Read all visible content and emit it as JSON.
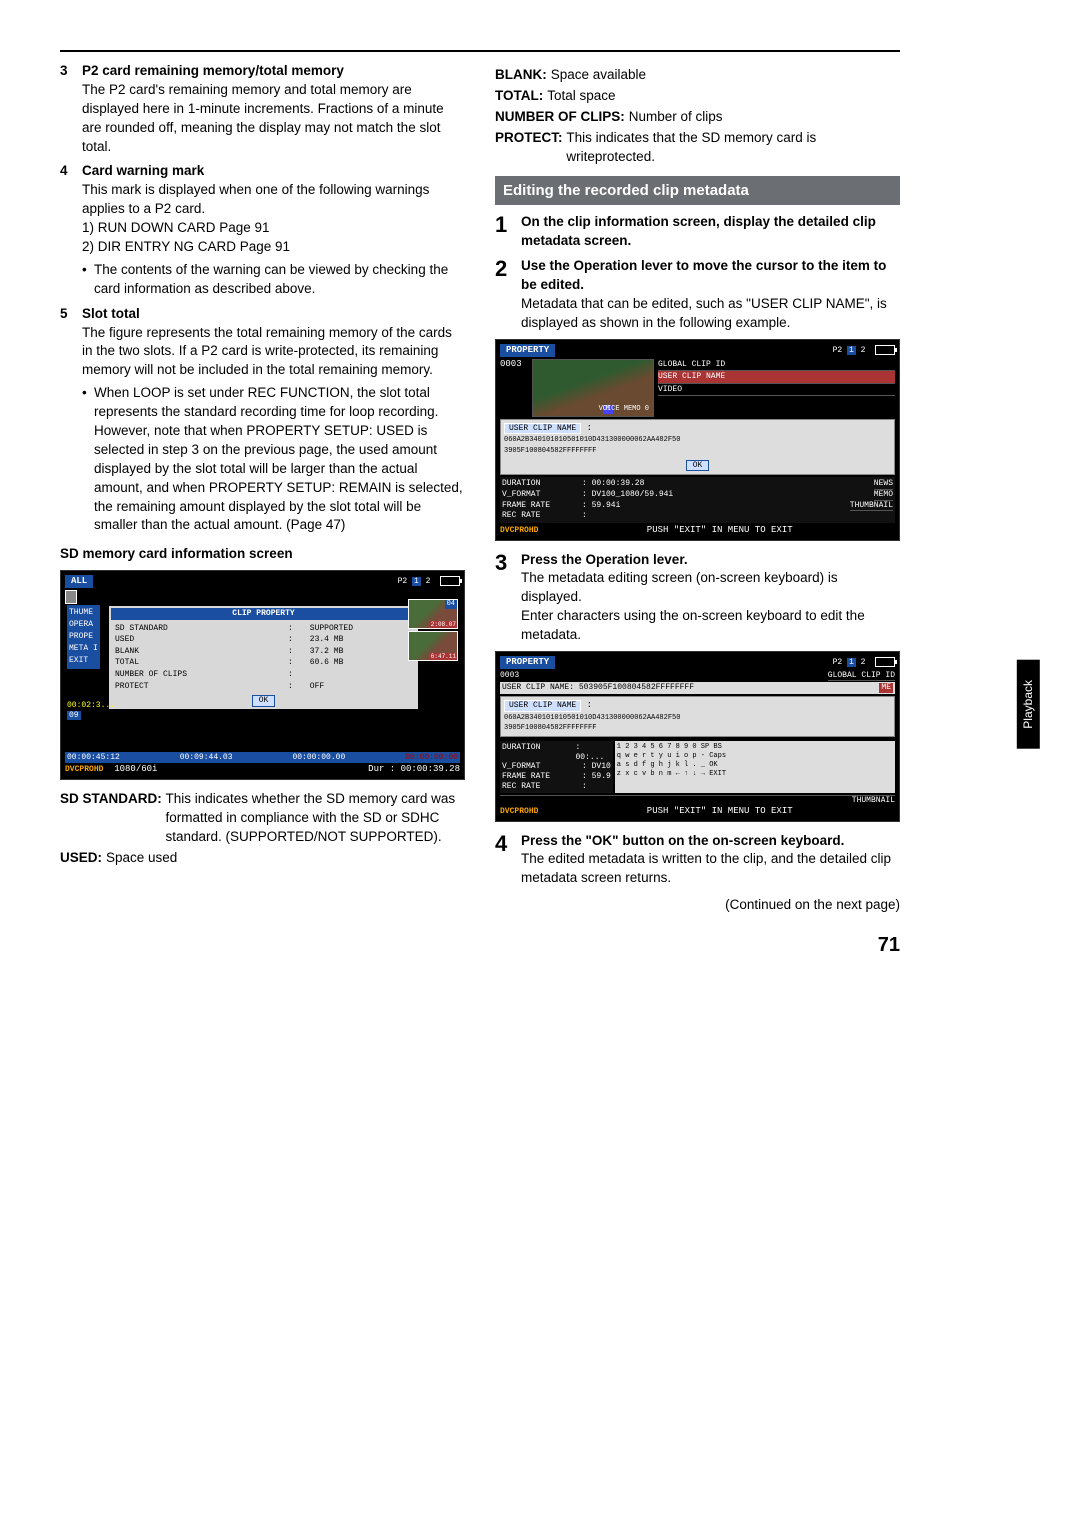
{
  "left": {
    "item3": {
      "num": "3",
      "title": "P2 card remaining memory/total memory",
      "body": "The P2 card's remaining memory and total memory are displayed here in 1-minute increments. Fractions of a minute are rounded off, meaning the display may not match the slot total."
    },
    "item4": {
      "num": "4",
      "title": "Card warning mark",
      "body": "This mark is displayed when one of the following warnings applies to a P2 card.",
      "line1": "1) RUN DOWN CARD Page 91",
      "line2": "2) DIR ENTRY NG CARD Page 91",
      "bullet": "The contents of the warning can be viewed by checking the card information as described above."
    },
    "item5": {
      "num": "5",
      "title": "Slot total",
      "body": "The figure represents the total remaining memory of the cards in the two slots. If a P2 card is write-protected, its remaining memory will not be included in the total remaining memory.",
      "bullet": "When LOOP is set under REC FUNCTION, the slot total represents the standard recording time for loop recording. However, note that when PROPERTY SETUP: USED is selected in step 3 on the previous page, the used amount displayed by the slot total will be larger than the actual amount, and when PROPERTY SETUP: REMAIN is selected, the remaining amount displayed by the slot total will be smaller than the actual amount. (Page 47)"
    },
    "sdHeading": "SD memory card information screen",
    "sdScreen": {
      "all": "ALL",
      "p2": "P2",
      "menu": [
        "THUME",
        "OPERA",
        "PROPE",
        "META I",
        "EXIT"
      ],
      "panelTitle": "CLIP PROPERTY",
      "rows": [
        [
          "SD STANDARD",
          ":",
          "SUPPORTED"
        ],
        [
          "USED",
          ":",
          "23.4 MB"
        ],
        [
          "BLANK",
          ":",
          "37.2 MB"
        ],
        [
          "TOTAL",
          ":",
          "60.6 MB"
        ],
        [
          "NUMBER OF CLIPS",
          ":",
          ""
        ],
        [
          "PROTECT",
          ":",
          "OFF"
        ]
      ],
      "ok": "OK",
      "tc1": "00:02:3...",
      "tnum": "09",
      "th1n": "04",
      "th1t": "2:08.07",
      "th2t": "6:47.11",
      "time1": "00:00:45:12",
      "time2": "00:09:44.03",
      "time3": "00:00:00.00",
      "brand": "DVCPRO",
      "brandHD": "HD",
      "res": "1080/60i",
      "dur": "Dur : 00:00:39.28"
    },
    "defs": {
      "sdStd": {
        "k": "SD STANDARD:",
        "v": "This indicates whether the SD memory card was formatted in compliance with the SD or SDHC standard. (SUPPORTED/NOT SUPPORTED)."
      },
      "used": {
        "k": "USED:",
        "v": "Space used"
      }
    }
  },
  "right": {
    "topDefs": {
      "blank": {
        "k": "BLANK:",
        "v": "Space available"
      },
      "total": {
        "k": "TOTAL:",
        "v": "Total space"
      },
      "nclips": {
        "k": "NUMBER OF CLIPS:",
        "v": "Number of clips"
      },
      "protect": {
        "k": "PROTECT:",
        "v": "This indicates that the SD memory card is writeprotected."
      }
    },
    "sectionTitle": "Editing the recorded clip metadata",
    "step1": {
      "num": "1",
      "head": "On the clip information screen, display the detailed clip metadata screen."
    },
    "step2": {
      "num": "2",
      "head": "Use the Operation lever to move the cursor to the item to be edited.",
      "body": "Metadata that can be edited, such as \"USER CLIP NAME\", is displayed as shown in the following example."
    },
    "scr1": {
      "title": "PROPERTY",
      "p2": "P2",
      "clip": "0003",
      "side": [
        "GLOBAL CLIP ID",
        "USER CLIP NAME",
        "VIDEO"
      ],
      "m": "M",
      "vm": "VOICE MEMO  0",
      "ucn": "USER CLIP NAME",
      "hex1": "060A2B340101010501010D431300000062AA482F50",
      "hex2": "3905F100804582FFFFFFFF",
      "ok": "OK",
      "rows": [
        [
          "DURATION",
          ": 00:00:39.28",
          "NEWS"
        ],
        [
          "V_FORMAT",
          ": DV100_1080/59.94i",
          "MEMO"
        ],
        [
          "FRAME RATE",
          ": 59.94i",
          "THUMBNAIL"
        ],
        [
          "REC RATE",
          ":",
          ""
        ]
      ],
      "brand": "DVCPRO",
      "brandHD": "HD",
      "exit": "PUSH \"EXIT\" IN MENU TO EXIT"
    },
    "step3": {
      "num": "3",
      "head": "Press the Operation lever.",
      "body1": "The metadata editing screen (on-screen keyboard) is displayed.",
      "body2": "Enter characters using the on-screen keyboard to edit the metadata."
    },
    "scr2": {
      "title": "PROPERTY",
      "p2": "P2",
      "clip": "0003",
      "gcid": "GLOBAL CLIP ID",
      "me": "ME",
      "ucnVal": "USER CLIP NAME: 503905F100804582FFFFFFFF",
      "ucn": "USER CLIP NAME",
      "hex1": "060A2B340101010501010D431300000062AA482F50",
      "hex2": "3905F100804582FFFFFFFF",
      "kb1": "1 2 3 4 5 6 7 8 9 0 SP BS",
      "kb2": "q w e r t y u i o p - Caps",
      "kb3": "a s d f g h j k l . _ OK",
      "kb4": "z x c v b n m ← ↑ ↓ → EXIT",
      "rows": [
        [
          "DURATION",
          ": 00:..."
        ],
        [
          "V_FORMAT",
          ": DV10"
        ],
        [
          "FRAME RATE",
          ": 59.9"
        ],
        [
          "REC RATE",
          ":"
        ]
      ],
      "thumb": "THUMBNAIL",
      "brand": "DVCPRO",
      "brandHD": "HD",
      "exit": "PUSH \"EXIT\" IN MENU TO EXIT"
    },
    "step4": {
      "num": "4",
      "head": "Press the \"OK\" button on the on-screen keyboard.",
      "body": "The edited metadata is written to the clip, and the detailed clip metadata screen returns."
    },
    "continued": "(Continued on the next page)"
  },
  "sideTab": "Playback",
  "pageNum": "71"
}
